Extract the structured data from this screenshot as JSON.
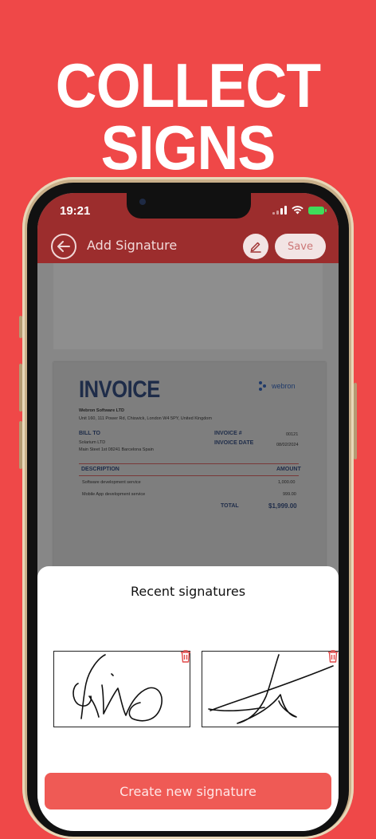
{
  "headline": "COLLECT SIGNS",
  "status_bar": {
    "time": "19:21"
  },
  "header": {
    "back_icon": "arrow-left-icon",
    "title": "Add Signature",
    "edit_icon": "pen-icon",
    "save_label": "Save"
  },
  "invoice": {
    "title": "INVOICE",
    "logo_text": "webron",
    "company_name": "Webron Software LTD",
    "company_address": "Unit 160, 111 Power Rd, Chiswick, London W4 5PY, United Kingdom",
    "bill_to_label": "BILL TO",
    "client_name": "Solarium LTD",
    "client_address": "Main Steet 1st 08241 Barcelona Spain",
    "invoice_no_label": "INVOICE #",
    "invoice_no": "00121",
    "invoice_date_label": "INVOICE DATE",
    "invoice_date": "08/02/2024",
    "col_description": "DESCRIPTION",
    "col_amount": "AMOUNT",
    "items": [
      {
        "description": "Software development service",
        "amount": "1,000.00"
      },
      {
        "description": "Mobile App development service",
        "amount": "999.00"
      }
    ],
    "total_label": "TOTAL",
    "total_value": "$1,999.00"
  },
  "sheet": {
    "title": "Recent signatures",
    "delete_icon": "trash-icon",
    "create_label": "Create new signature"
  },
  "colors": {
    "background": "#ef4848",
    "header": "#9c2d2d",
    "primary_button": "#ef5a55",
    "invoice_navy": "#1e2c49",
    "trash": "#e14a4a"
  }
}
